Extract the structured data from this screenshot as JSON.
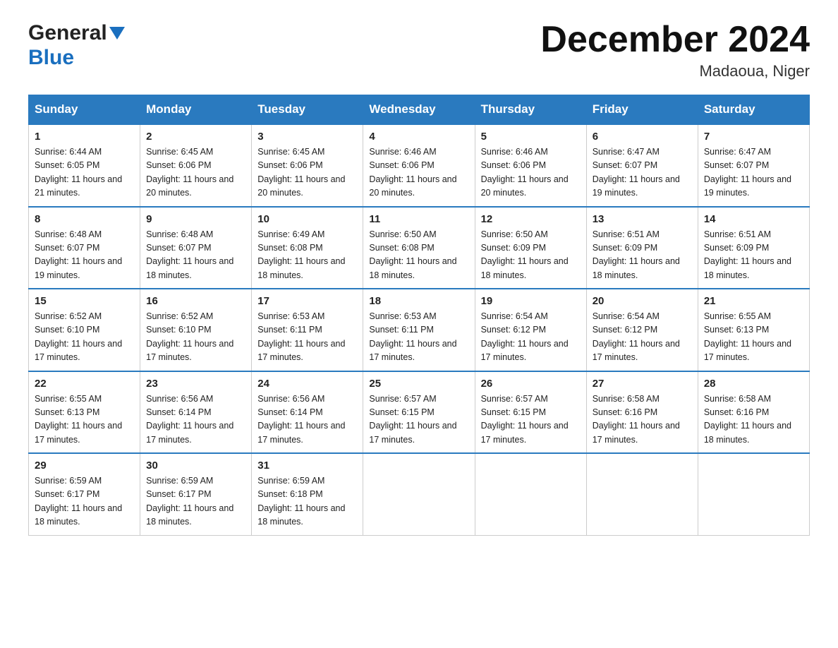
{
  "header": {
    "logo_general": "General",
    "logo_blue": "Blue",
    "month_title": "December 2024",
    "location": "Madaoua, Niger"
  },
  "days_of_week": [
    "Sunday",
    "Monday",
    "Tuesday",
    "Wednesday",
    "Thursday",
    "Friday",
    "Saturday"
  ],
  "weeks": [
    [
      {
        "day": "1",
        "sunrise": "6:44 AM",
        "sunset": "6:05 PM",
        "daylight": "11 hours and 21 minutes."
      },
      {
        "day": "2",
        "sunrise": "6:45 AM",
        "sunset": "6:06 PM",
        "daylight": "11 hours and 20 minutes."
      },
      {
        "day": "3",
        "sunrise": "6:45 AM",
        "sunset": "6:06 PM",
        "daylight": "11 hours and 20 minutes."
      },
      {
        "day": "4",
        "sunrise": "6:46 AM",
        "sunset": "6:06 PM",
        "daylight": "11 hours and 20 minutes."
      },
      {
        "day": "5",
        "sunrise": "6:46 AM",
        "sunset": "6:06 PM",
        "daylight": "11 hours and 20 minutes."
      },
      {
        "day": "6",
        "sunrise": "6:47 AM",
        "sunset": "6:07 PM",
        "daylight": "11 hours and 19 minutes."
      },
      {
        "day": "7",
        "sunrise": "6:47 AM",
        "sunset": "6:07 PM",
        "daylight": "11 hours and 19 minutes."
      }
    ],
    [
      {
        "day": "8",
        "sunrise": "6:48 AM",
        "sunset": "6:07 PM",
        "daylight": "11 hours and 19 minutes."
      },
      {
        "day": "9",
        "sunrise": "6:48 AM",
        "sunset": "6:07 PM",
        "daylight": "11 hours and 18 minutes."
      },
      {
        "day": "10",
        "sunrise": "6:49 AM",
        "sunset": "6:08 PM",
        "daylight": "11 hours and 18 minutes."
      },
      {
        "day": "11",
        "sunrise": "6:50 AM",
        "sunset": "6:08 PM",
        "daylight": "11 hours and 18 minutes."
      },
      {
        "day": "12",
        "sunrise": "6:50 AM",
        "sunset": "6:09 PM",
        "daylight": "11 hours and 18 minutes."
      },
      {
        "day": "13",
        "sunrise": "6:51 AM",
        "sunset": "6:09 PM",
        "daylight": "11 hours and 18 minutes."
      },
      {
        "day": "14",
        "sunrise": "6:51 AM",
        "sunset": "6:09 PM",
        "daylight": "11 hours and 18 minutes."
      }
    ],
    [
      {
        "day": "15",
        "sunrise": "6:52 AM",
        "sunset": "6:10 PM",
        "daylight": "11 hours and 17 minutes."
      },
      {
        "day": "16",
        "sunrise": "6:52 AM",
        "sunset": "6:10 PM",
        "daylight": "11 hours and 17 minutes."
      },
      {
        "day": "17",
        "sunrise": "6:53 AM",
        "sunset": "6:11 PM",
        "daylight": "11 hours and 17 minutes."
      },
      {
        "day": "18",
        "sunrise": "6:53 AM",
        "sunset": "6:11 PM",
        "daylight": "11 hours and 17 minutes."
      },
      {
        "day": "19",
        "sunrise": "6:54 AM",
        "sunset": "6:12 PM",
        "daylight": "11 hours and 17 minutes."
      },
      {
        "day": "20",
        "sunrise": "6:54 AM",
        "sunset": "6:12 PM",
        "daylight": "11 hours and 17 minutes."
      },
      {
        "day": "21",
        "sunrise": "6:55 AM",
        "sunset": "6:13 PM",
        "daylight": "11 hours and 17 minutes."
      }
    ],
    [
      {
        "day": "22",
        "sunrise": "6:55 AM",
        "sunset": "6:13 PM",
        "daylight": "11 hours and 17 minutes."
      },
      {
        "day": "23",
        "sunrise": "6:56 AM",
        "sunset": "6:14 PM",
        "daylight": "11 hours and 17 minutes."
      },
      {
        "day": "24",
        "sunrise": "6:56 AM",
        "sunset": "6:14 PM",
        "daylight": "11 hours and 17 minutes."
      },
      {
        "day": "25",
        "sunrise": "6:57 AM",
        "sunset": "6:15 PM",
        "daylight": "11 hours and 17 minutes."
      },
      {
        "day": "26",
        "sunrise": "6:57 AM",
        "sunset": "6:15 PM",
        "daylight": "11 hours and 17 minutes."
      },
      {
        "day": "27",
        "sunrise": "6:58 AM",
        "sunset": "6:16 PM",
        "daylight": "11 hours and 17 minutes."
      },
      {
        "day": "28",
        "sunrise": "6:58 AM",
        "sunset": "6:16 PM",
        "daylight": "11 hours and 18 minutes."
      }
    ],
    [
      {
        "day": "29",
        "sunrise": "6:59 AM",
        "sunset": "6:17 PM",
        "daylight": "11 hours and 18 minutes."
      },
      {
        "day": "30",
        "sunrise": "6:59 AM",
        "sunset": "6:17 PM",
        "daylight": "11 hours and 18 minutes."
      },
      {
        "day": "31",
        "sunrise": "6:59 AM",
        "sunset": "6:18 PM",
        "daylight": "11 hours and 18 minutes."
      },
      null,
      null,
      null,
      null
    ]
  ]
}
